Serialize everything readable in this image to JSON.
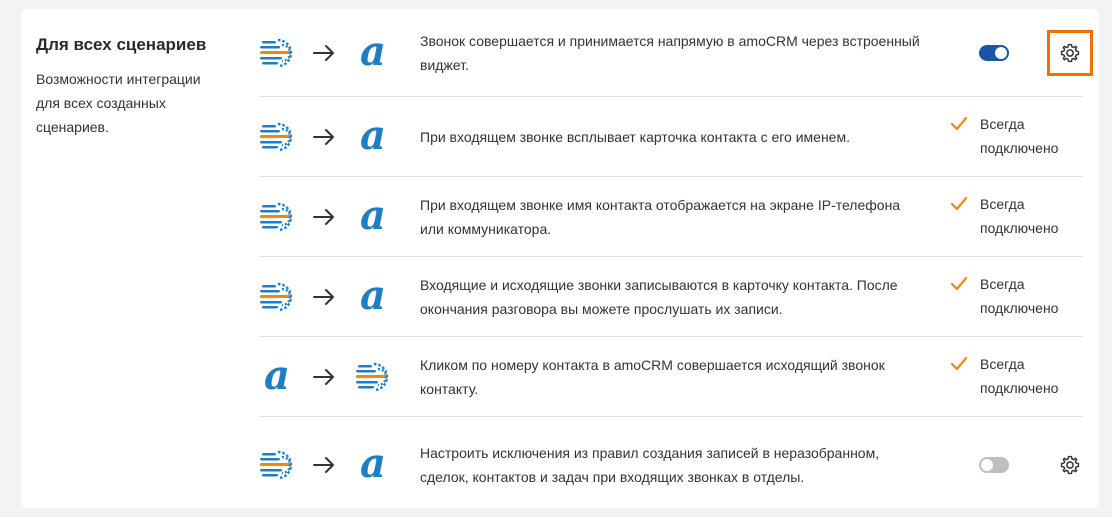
{
  "section": {
    "title": "Для всех сценариев",
    "description": "Возможности интеграции для всех созданных сценариев."
  },
  "status_label": "Всегда подключено",
  "colors": {
    "accent": "#1c55a6",
    "highlight": "#f07100",
    "check": "#f08a00",
    "amo_blue": "#1f7ec2"
  },
  "rows": [
    {
      "direction": "telephony-to-amo",
      "text": "Звонок совершается и принимается напрямую в amoCRM через встроенный виджет.",
      "control": "toggle",
      "toggle_on": true,
      "settings": true,
      "settings_highlight": true
    },
    {
      "direction": "telephony-to-amo",
      "text": "При входящем звонке всплывает карточка контакта с его именем.",
      "control": "always"
    },
    {
      "direction": "telephony-to-amo",
      "text": "При входящем звонке имя контакта отображается на экране IP-телефона или коммуникатора.",
      "control": "always"
    },
    {
      "direction": "telephony-to-amo",
      "text": "Входящие и исходящие звонки записываются в карточку контакта. После окончания разговора вы можете прослушать их записи.",
      "control": "always"
    },
    {
      "direction": "amo-to-telephony",
      "text": "Кликом по номеру контакта в amoCRM совершается исходящий звонок контакту.",
      "control": "always"
    },
    {
      "direction": "telephony-to-amo",
      "text": "Настроить исключения из правил создания записей в неразобранном, сделок, контактов и задач при входящих звонках в отделы.",
      "control": "toggle",
      "toggle_on": false,
      "settings": true,
      "settings_highlight": false
    }
  ]
}
